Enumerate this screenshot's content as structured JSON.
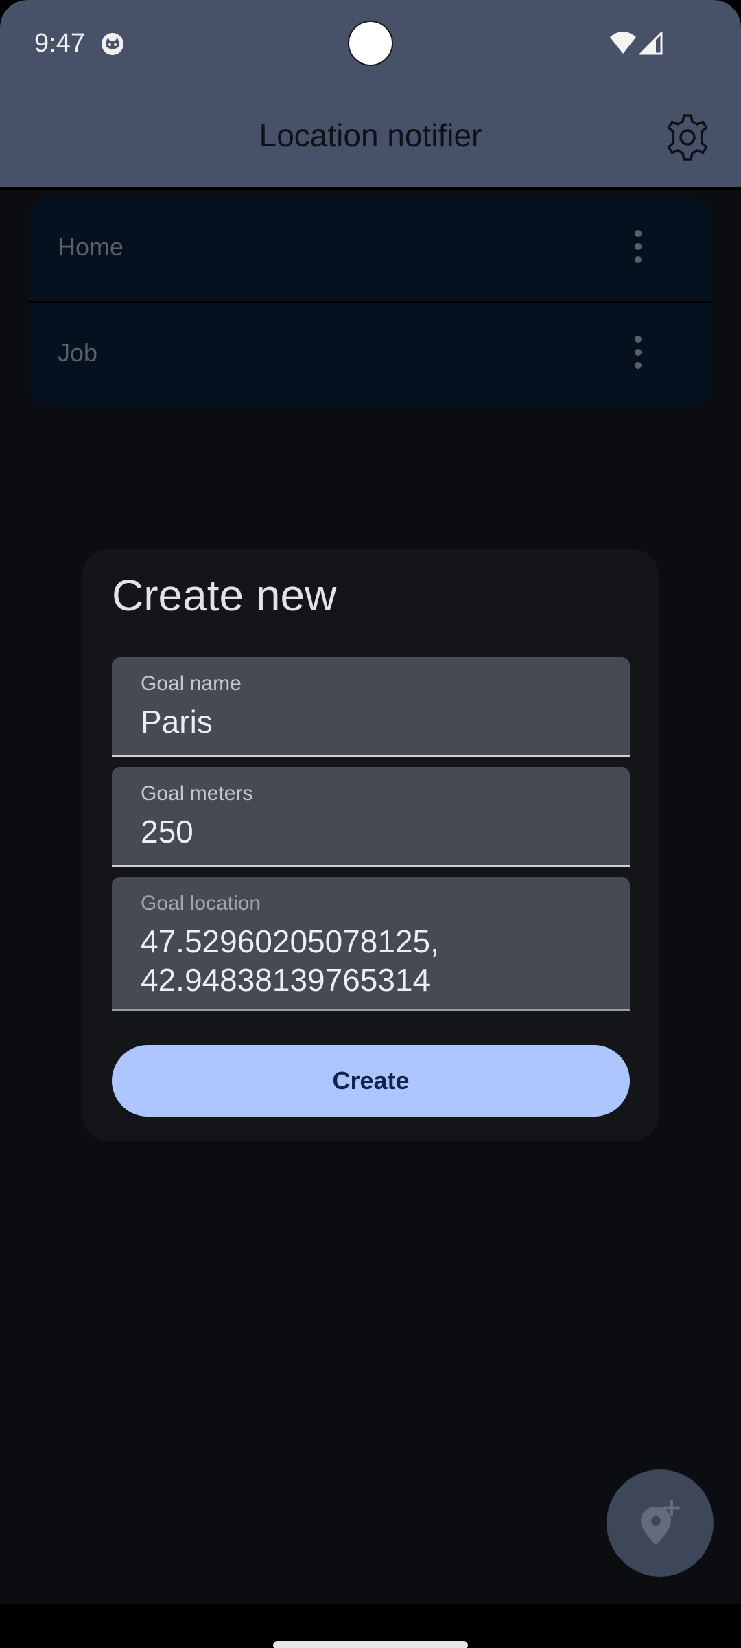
{
  "status_bar": {
    "time": "9:47",
    "icons": [
      "app-notification-icon",
      "wifi-icon",
      "signal-icon"
    ]
  },
  "app_bar": {
    "title": "Location notifier",
    "action_icon": "settings-gear-icon"
  },
  "goals": {
    "items": [
      {
        "label": "Home",
        "menu_icon": "more-vert-icon"
      },
      {
        "label": "Job",
        "menu_icon": "more-vert-icon"
      }
    ]
  },
  "dialog": {
    "title": "Create new",
    "fields": [
      {
        "label": "Goal name",
        "value": "Paris"
      },
      {
        "label": "Goal meters",
        "value": "250"
      },
      {
        "label": "Goal location",
        "value": "47.52960205078125,\n42.94838139765314"
      }
    ],
    "create_label": "Create"
  },
  "fab": {
    "icon": "add-location-icon"
  },
  "colors": {
    "header": "#475168",
    "background": "#0b0d11",
    "list_item": "#06111f",
    "dialog": "#131519",
    "field": "#474a54",
    "primary_button": "#adc6ff",
    "primary_button_text": "#11244a",
    "fab": "#3e4759"
  }
}
